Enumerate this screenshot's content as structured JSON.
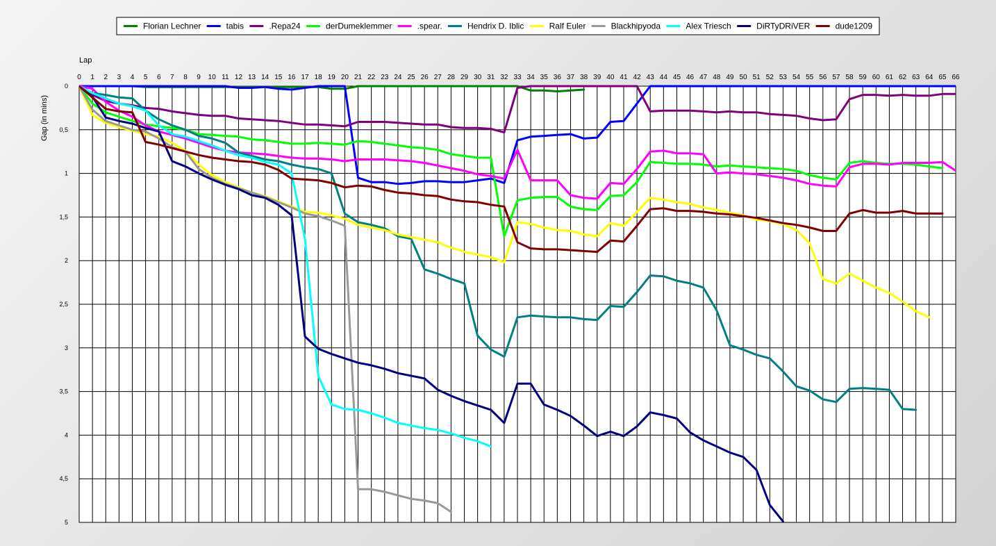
{
  "chart_data": {
    "type": "line",
    "title": "",
    "xlabel": "Lap",
    "ylabel": "Gap (in mins)",
    "xlim": [
      0,
      66
    ],
    "ylim": [
      0,
      5
    ],
    "y_inverted": true,
    "grid": true,
    "legend_position": "top",
    "x_ticks": [
      0,
      1,
      2,
      3,
      4,
      5,
      6,
      7,
      8,
      9,
      10,
      11,
      12,
      13,
      14,
      15,
      16,
      17,
      18,
      19,
      20,
      21,
      22,
      23,
      24,
      25,
      26,
      27,
      28,
      29,
      30,
      31,
      32,
      33,
      34,
      35,
      36,
      37,
      38,
      39,
      40,
      41,
      42,
      43,
      44,
      45,
      46,
      47,
      48,
      49,
      50,
      51,
      52,
      53,
      54,
      55,
      56,
      57,
      58,
      59,
      60,
      61,
      62,
      63,
      64,
      65,
      66
    ],
    "y_ticks": [
      {
        "value": 0,
        "label": "0"
      },
      {
        "value": 0.5,
        "label": "0,5"
      },
      {
        "value": 1,
        "label": "1"
      },
      {
        "value": 1.5,
        "label": "1,5"
      },
      {
        "value": 2,
        "label": "2"
      },
      {
        "value": 2.5,
        "label": "2,5"
      },
      {
        "value": 3,
        "label": "3"
      },
      {
        "value": 3.5,
        "label": "3,5"
      },
      {
        "value": 4,
        "label": "4"
      },
      {
        "value": 4.5,
        "label": "4,5"
      },
      {
        "value": 5,
        "label": "5"
      }
    ],
    "series": [
      {
        "name": "Florian Lechner",
        "color": "#008000",
        "values": [
          0,
          0,
          0,
          0,
          0,
          0.01,
          0.01,
          0.01,
          0.01,
          0.01,
          0.01,
          0.01,
          0.01,
          0.01,
          0.01,
          0.01,
          0.01,
          0.01,
          0.01,
          0.03,
          0.03,
          0,
          0,
          0,
          0,
          0,
          0,
          0,
          0,
          0,
          0,
          0,
          0,
          0,
          0.05,
          0.05,
          0.06,
          0.05,
          0.04
        ]
      },
      {
        "name": "tabis",
        "color": "#0000ff",
        "values": [
          0,
          0,
          0,
          0,
          0,
          0,
          0,
          0,
          0,
          0,
          0,
          0,
          0.02,
          0.02,
          0.01,
          0.03,
          0.04,
          0.02,
          0,
          0,
          0,
          1.05,
          1.1,
          1.1,
          1.12,
          1.11,
          1.09,
          1.09,
          1.1,
          1.1,
          1.08,
          1.06,
          1.11,
          0.62,
          0.58,
          0.57,
          0.56,
          0.55,
          0.6,
          0.59,
          0.41,
          0.4,
          0.2,
          0,
          0,
          0,
          0,
          0,
          0,
          0,
          0,
          0,
          0,
          0,
          0,
          0,
          0,
          0,
          0,
          0,
          0,
          0,
          0,
          0,
          0,
          0,
          0
        ]
      },
      {
        "name": ".Repa24",
        "color": "#800080",
        "values": [
          0,
          0.1,
          0.17,
          0.2,
          0.22,
          0.25,
          0.26,
          0.29,
          0.31,
          0.33,
          0.34,
          0.34,
          0.37,
          0.38,
          0.39,
          0.4,
          0.42,
          0.44,
          0.44,
          0.45,
          0.46,
          0.41,
          0.41,
          0.41,
          0.42,
          0.43,
          0.44,
          0.44,
          0.47,
          0.48,
          0.48,
          0.49,
          0.53,
          0.02,
          0,
          0,
          0,
          0,
          0,
          0,
          0,
          0,
          0,
          0.29,
          0.28,
          0.28,
          0.28,
          0.29,
          0.3,
          0.29,
          0.3,
          0.3,
          0.32,
          0.33,
          0.34,
          0.37,
          0.39,
          0.38,
          0.15,
          0.1,
          0.1,
          0.11,
          0.1,
          0.11,
          0.11,
          0.09,
          0.09
        ]
      },
      {
        "name": "derDumeklemmer",
        "color": "#00ff00",
        "values": [
          0,
          0.2,
          0.3,
          0.35,
          0.4,
          0.44,
          0.46,
          0.48,
          0.5,
          0.55,
          0.56,
          0.57,
          0.58,
          0.61,
          0.62,
          0.64,
          0.66,
          0.66,
          0.65,
          0.66,
          0.67,
          0.63,
          0.64,
          0.66,
          0.68,
          0.7,
          0.71,
          0.73,
          0.78,
          0.8,
          0.82,
          0.82,
          1.72,
          1.31,
          1.28,
          1.27,
          1.27,
          1.38,
          1.41,
          1.42,
          1.26,
          1.25,
          1.1,
          0.87,
          0.88,
          0.89,
          0.89,
          0.9,
          0.92,
          0.91,
          0.92,
          0.93,
          0.94,
          0.95,
          0.97,
          1.02,
          1.05,
          1.07,
          0.88,
          0.86,
          0.88,
          0.89,
          0.89,
          0.9,
          0.92,
          0.94
        ]
      },
      {
        "name": ".spear.",
        "color": "#ff00ff",
        "values": [
          0,
          0.03,
          0.18,
          0.28,
          0.35,
          0.45,
          0.52,
          0.56,
          0.6,
          0.65,
          0.7,
          0.74,
          0.76,
          0.77,
          0.78,
          0.8,
          0.82,
          0.83,
          0.83,
          0.84,
          0.86,
          0.84,
          0.84,
          0.84,
          0.85,
          0.86,
          0.88,
          0.91,
          0.94,
          0.97,
          1.01,
          1.03,
          1.06,
          0.73,
          1.08,
          1.08,
          1.08,
          1.25,
          1.28,
          1.29,
          1.11,
          1.12,
          0.95,
          0.75,
          0.74,
          0.77,
          0.77,
          0.78,
          1,
          0.99,
          1,
          1.01,
          1.03,
          1.05,
          1.08,
          1.12,
          1.14,
          1.15,
          0.93,
          0.89,
          0.89,
          0.9,
          0.88,
          0.88,
          0.88,
          0.87,
          0.97
        ]
      },
      {
        "name": "Hendrix D. Iblic",
        "color": "#008080",
        "values": [
          0,
          0.08,
          0.1,
          0.13,
          0.14,
          0.28,
          0.38,
          0.45,
          0.5,
          0.57,
          0.6,
          0.65,
          0.76,
          0.8,
          0.84,
          0.86,
          0.9,
          0.93,
          0.95,
          1.0,
          1.46,
          1.56,
          1.59,
          1.63,
          1.72,
          1.75,
          2.1,
          2.15,
          2.21,
          2.26,
          2.86,
          3.02,
          3.1,
          2.65,
          2.63,
          2.64,
          2.65,
          2.65,
          2.67,
          2.68,
          2.52,
          2.53,
          2.36,
          2.17,
          2.18,
          2.23,
          2.26,
          2.31,
          2.57,
          2.97,
          3.02,
          3.08,
          3.12,
          3.27,
          3.44,
          3.49,
          3.59,
          3.62,
          3.47,
          3.46,
          3.47,
          3.48,
          3.7,
          3.71
        ]
      },
      {
        "name": "Ralf Euler",
        "color": "#ffff00",
        "values": [
          0,
          0.33,
          0.42,
          0.47,
          0.51,
          0.55,
          0.58,
          0.65,
          0.74,
          0.9,
          1.02,
          1.1,
          1.16,
          1.22,
          1.26,
          1.32,
          1.38,
          1.44,
          1.45,
          1.48,
          1.52,
          1.59,
          1.62,
          1.65,
          1.7,
          1.73,
          1.76,
          1.79,
          1.85,
          1.9,
          1.93,
          1.96,
          2.02,
          1.56,
          1.58,
          1.62,
          1.65,
          1.66,
          1.7,
          1.72,
          1.57,
          1.6,
          1.44,
          1.28,
          1.3,
          1.33,
          1.35,
          1.39,
          1.42,
          1.45,
          1.48,
          1.53,
          1.55,
          1.58,
          1.65,
          1.8,
          2.21,
          2.26,
          2.15,
          2.23,
          2.31,
          2.37,
          2.47,
          2.58,
          2.65
        ]
      },
      {
        "name": "Blackhipyoda",
        "color": "#999999",
        "values": [
          0,
          0.27,
          0.4,
          0.45,
          0.5,
          0.52,
          0.6,
          0.7,
          0.75,
          0.95,
          1.05,
          1.12,
          1.17,
          1.22,
          1.27,
          1.33,
          1.39,
          1.46,
          1.49,
          1.54,
          1.6,
          4.62,
          4.62,
          4.65,
          4.69,
          4.73,
          4.75,
          4.78,
          4.88
        ]
      },
      {
        "name": "Alex Triesch",
        "color": "#00ffff",
        "values": [
          0,
          0.08,
          0.14,
          0.2,
          0.23,
          0.28,
          0.45,
          0.55,
          0.58,
          0.63,
          0.68,
          0.74,
          0.79,
          0.82,
          0.87,
          0.9,
          1.0,
          1.75,
          3.32,
          3.65,
          3.7,
          3.71,
          3.75,
          3.8,
          3.86,
          3.89,
          3.92,
          3.94,
          3.98,
          4.03,
          4.07,
          4.13
        ]
      },
      {
        "name": "DiRTyDRiVER",
        "color": "#000080",
        "values": [
          0,
          0.12,
          0.36,
          0.4,
          0.43,
          0.48,
          0.52,
          0.86,
          0.92,
          1.0,
          1.07,
          1.13,
          1.18,
          1.25,
          1.28,
          1.36,
          1.48,
          2.87,
          3.01,
          3.07,
          3.12,
          3.17,
          3.2,
          3.24,
          3.29,
          3.32,
          3.35,
          3.48,
          3.55,
          3.61,
          3.66,
          3.71,
          3.86,
          3.41,
          3.41,
          3.65,
          3.71,
          3.78,
          3.89,
          4.01,
          3.96,
          4.01,
          3.9,
          3.74,
          3.77,
          3.81,
          3.97,
          4.06,
          4.13,
          4.2,
          4.25,
          4.4,
          4.8,
          4.99
        ]
      },
      {
        "name": "dude1209",
        "color": "#800000",
        "values": [
          0,
          0.13,
          0.26,
          0.29,
          0.3,
          0.64,
          0.67,
          0.71,
          0.75,
          0.79,
          0.82,
          0.84,
          0.86,
          0.87,
          0.9,
          0.96,
          1.06,
          1.07,
          1.08,
          1.11,
          1.16,
          1.14,
          1.15,
          1.19,
          1.22,
          1.23,
          1.25,
          1.26,
          1.3,
          1.32,
          1.33,
          1.36,
          1.38,
          1.79,
          1.86,
          1.87,
          1.87,
          1.88,
          1.89,
          1.9,
          1.77,
          1.78,
          1.6,
          1.41,
          1.4,
          1.43,
          1.43,
          1.44,
          1.46,
          1.47,
          1.49,
          1.51,
          1.54,
          1.57,
          1.59,
          1.62,
          1.66,
          1.66,
          1.46,
          1.42,
          1.45,
          1.45,
          1.43,
          1.46,
          1.46,
          1.46
        ]
      }
    ]
  }
}
